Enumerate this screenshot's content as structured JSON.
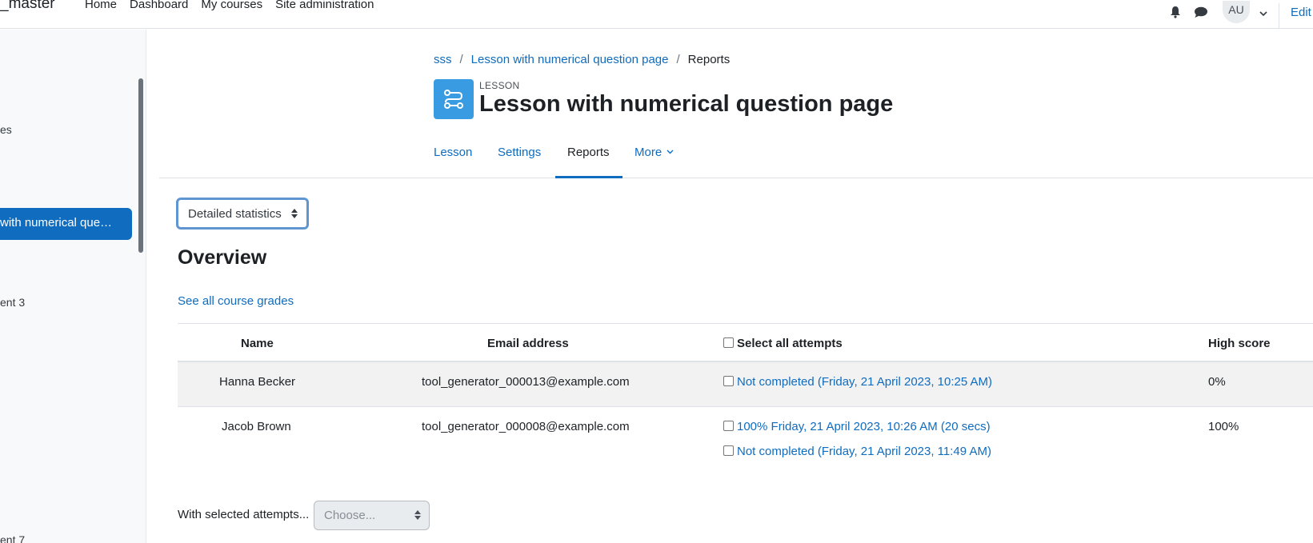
{
  "navbar": {
    "brand": "_master",
    "links": [
      "Home",
      "Dashboard",
      "My courses",
      "Site administration"
    ],
    "avatar_initials": "AU",
    "edit_mode_label": "Edit mode"
  },
  "drawer": {
    "items": [
      {
        "label": "es"
      },
      {
        "label": "ent 3"
      },
      {
        "label": "ent 7"
      }
    ],
    "active_item": "with numerical que…"
  },
  "breadcrumb": {
    "items": [
      "sss",
      "Lesson with numerical question page"
    ],
    "current": "Reports"
  },
  "header": {
    "pretitle": "LESSON",
    "title": "Lesson with numerical question page",
    "icon": "lesson-icon",
    "icon_bg": "#399be2"
  },
  "tabs": [
    {
      "label": "Lesson",
      "active": false
    },
    {
      "label": "Settings",
      "active": false
    },
    {
      "label": "Reports",
      "active": true
    },
    {
      "label": "More",
      "active": false
    }
  ],
  "report_select": {
    "value": "Detailed statistics"
  },
  "overview": {
    "title": "Overview",
    "grades_link": "See all course grades"
  },
  "table": {
    "headers": {
      "name": "Name",
      "email": "Email address",
      "attempts": "Select all attempts",
      "high_score": "High score"
    },
    "rows": [
      {
        "name": "Hanna Becker",
        "email": "tool_generator_000013@example.com",
        "attempts": [
          "Not completed (Friday, 21 April 2023, 10:25 AM)"
        ],
        "high_score": "0%"
      },
      {
        "name": "Jacob Brown",
        "email": "tool_generator_000008@example.com",
        "attempts": [
          "100% Friday, 21 April 2023, 10:26 AM (20 secs)",
          "Not completed (Friday, 21 April 2023, 11:49 AM)"
        ],
        "high_score": "100%"
      }
    ]
  },
  "bulk": {
    "label": "With selected attempts...",
    "placeholder": "Choose..."
  },
  "colors": {
    "accent": "#0f6cbf",
    "text": "#1d2125"
  }
}
